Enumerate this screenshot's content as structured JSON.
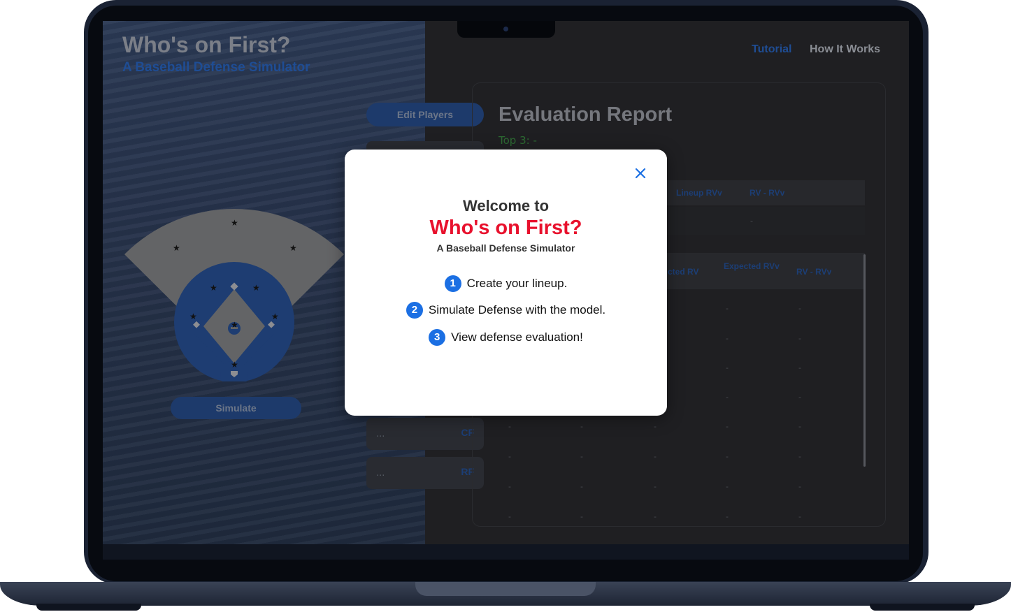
{
  "app": {
    "title": "Who's on First?",
    "subtitle": "A Baseball Defense Simulator"
  },
  "nav": {
    "tutorial_label": "Tutorial",
    "how_label": "How It Works"
  },
  "field": {
    "simulate_label": "Simulate"
  },
  "lineup": {
    "edit_label": "Edit Players",
    "slots": [
      {
        "name": "...",
        "position": "CF"
      },
      {
        "name": "...",
        "position": "RF"
      }
    ]
  },
  "report": {
    "title": "Evaluation Report",
    "top3": "Top 3: -",
    "table1": {
      "headers": [
        "Lineup RVv",
        "RV - RVv"
      ],
      "row": [
        "-"
      ]
    },
    "table2": {
      "headers": [
        "cted RV",
        "Expected RVv",
        "RV - RVv"
      ],
      "cell": "-"
    }
  },
  "modal": {
    "welcome": "Welcome to",
    "title": "Who's on First?",
    "subtitle": "A Baseball Defense Simulator",
    "steps": [
      {
        "num": "1",
        "text": "Create your lineup."
      },
      {
        "num": "2",
        "text": "Simulate Defense with the model."
      },
      {
        "num": "3",
        "text": "View defense evaluation!"
      }
    ],
    "close_icon": "close-icon"
  },
  "colors": {
    "accent_blue": "#1b6fe3",
    "brand_red": "#e8112d",
    "dim_blue": "#1d3a6b"
  }
}
